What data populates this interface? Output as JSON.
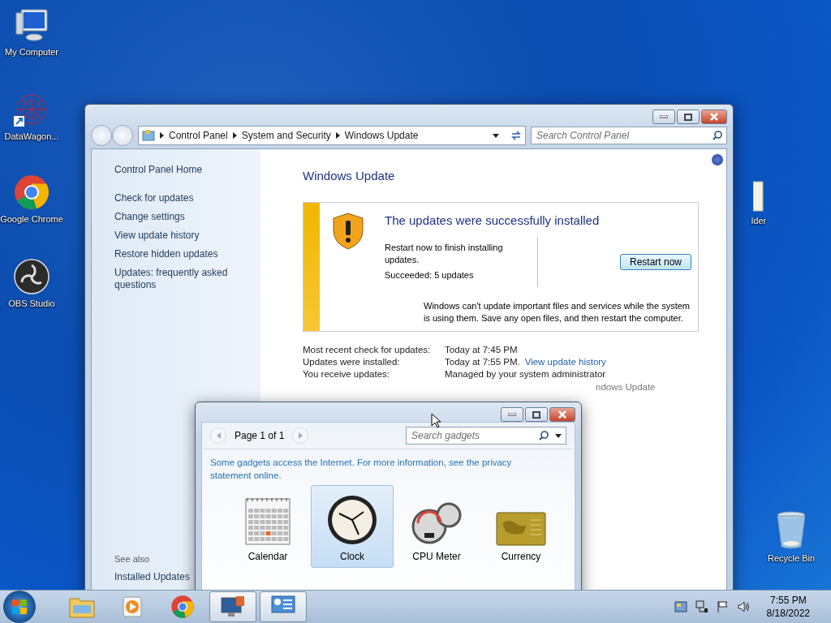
{
  "desktop_icons": [
    {
      "kind": "computer",
      "label": "My Computer"
    },
    {
      "kind": "network",
      "label": "DataWagon..."
    },
    {
      "kind": "chrome",
      "label": "Google Chrome"
    },
    {
      "kind": "obs",
      "label": "OBS Studio"
    },
    {
      "kind": "folder",
      "label": "lder"
    },
    {
      "kind": "recycle",
      "label": "Recycle Bin"
    }
  ],
  "control_panel": {
    "breadcrumb": [
      "Control Panel",
      "System and Security",
      "Windows Update"
    ],
    "search": {
      "placeholder": "Search Control Panel"
    },
    "sidebar": {
      "home": "Control Panel Home",
      "links": [
        "Check for updates",
        "Change settings",
        "View update history",
        "Restore hidden updates",
        "Updates: frequently asked questions"
      ],
      "see_also": {
        "title": "See also",
        "links": [
          "Installed Updates"
        ]
      }
    },
    "title": "Windows Update",
    "banner": {
      "title": "The updates were successfully installed",
      "message": "Restart now to finish installing updates.",
      "succeeded": "Succeeded: 5 updates",
      "button": "Restart now",
      "note": "Windows can't update important files and services while the system is using them. Save any open files, and then restart the computer."
    },
    "info": [
      {
        "label": "Most recent check for updates:",
        "value": "Today at 7:45 PM"
      },
      {
        "label": "Updates were installed:",
        "value": "Today at 7:55 PM.",
        "link": "View update history"
      },
      {
        "label": "You receive updates:",
        "value": "Managed by your system administrator"
      }
    ],
    "covered_text": "ndows Update"
  },
  "gadgets_window": {
    "page": "Page 1 of 1",
    "search": {
      "placeholder": "Search gadgets"
    },
    "notice": "Some gadgets access the Internet.  For more information, see the privacy statement online.",
    "gadgets": [
      {
        "kind": "calendar",
        "label": "Calendar",
        "selected": false
      },
      {
        "kind": "clock",
        "label": "Clock",
        "selected": true
      },
      {
        "kind": "cpu",
        "label": "CPU Meter",
        "selected": false
      },
      {
        "kind": "currency",
        "label": "Currency",
        "selected": false
      }
    ]
  },
  "taskbar": {
    "items": [
      {
        "kind": "explorer",
        "active": false
      },
      {
        "kind": "media",
        "active": false
      },
      {
        "kind": "chrome",
        "active": false
      },
      {
        "kind": "monitor",
        "active": true
      },
      {
        "kind": "gadgets",
        "active": true
      }
    ],
    "time": "7:55 PM",
    "date": "8/18/2022"
  }
}
